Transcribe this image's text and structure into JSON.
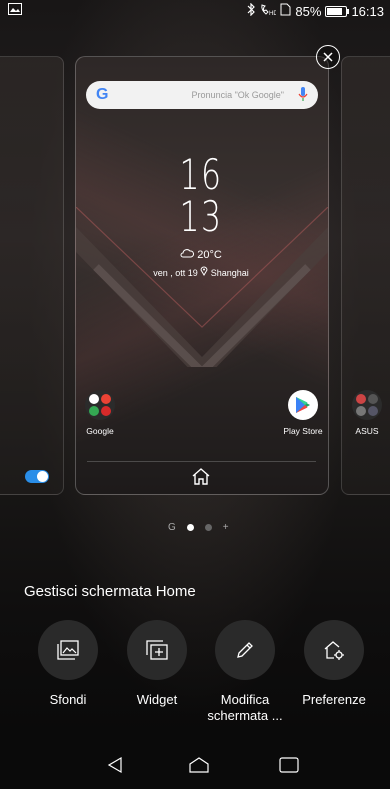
{
  "status_bar": {
    "battery_percent": "85%",
    "battery_level": 0.85,
    "time": "16:13"
  },
  "preview": {
    "search_placeholder": "Pronuncia \"Ok Google\"",
    "google_letter": "G",
    "clock_hour": "16",
    "clock_minute": "13",
    "weather_temp": "20°C",
    "date_location": "ven , ott 19",
    "location": "Shanghai",
    "apps": [
      {
        "label": "Google"
      },
      {
        "label": "Play Store"
      },
      {
        "label": "ASUS"
      }
    ]
  },
  "page_indicator": {
    "g_marker": "G",
    "plus": "+"
  },
  "manage": {
    "title": "Gestisci schermata Home",
    "actions": [
      {
        "label": "Sfondi"
      },
      {
        "label": "Widget"
      },
      {
        "label": "Modifica schermata ..."
      },
      {
        "label": "Preferenze"
      }
    ]
  },
  "colors": {
    "toggle": "#2a8ee8",
    "accent_blue": "#4285F4"
  }
}
